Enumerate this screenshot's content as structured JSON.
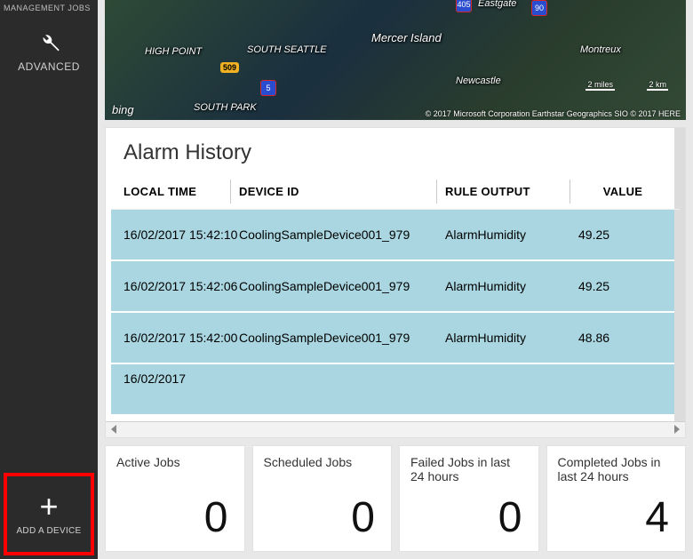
{
  "sidebar": {
    "mgmt_jobs": "MANAGEMENT JOBS",
    "advanced_label": "ADVANCED",
    "add_device_label": "ADD A DEVICE"
  },
  "map": {
    "labels": {
      "high_point": "HIGH POINT",
      "south_seattle": "SOUTH SEATTLE",
      "mercer_island": "Mercer Island",
      "eastgate": "Eastgate",
      "newcastle": "Newcastle",
      "montreux": "Montreux",
      "south_park": "SOUTH PARK"
    },
    "routes": {
      "r509": "509",
      "i5": "5",
      "i405": "405",
      "i90": "90"
    },
    "bing": "bing",
    "scale_miles": "2 miles",
    "scale_km": "2 km",
    "credits": "© 2017 Microsoft Corporation    Earthstar Geographics SIO    © 2017 HERE"
  },
  "alarm": {
    "title": "Alarm History",
    "columns": {
      "local_time": "LOCAL TIME",
      "device_id": "DEVICE ID",
      "rule_output": "RULE OUTPUT",
      "value": "VALUE"
    },
    "rows": [
      {
        "time": "16/02/2017 15:42:10",
        "device": "CoolingSampleDevice001_979",
        "rule": "AlarmHumidity",
        "value": "49.25"
      },
      {
        "time": "16/02/2017 15:42:06",
        "device": "CoolingSampleDevice001_979",
        "rule": "AlarmHumidity",
        "value": "49.25"
      },
      {
        "time": "16/02/2017 15:42:00",
        "device": "CoolingSampleDevice001_979",
        "rule": "AlarmHumidity",
        "value": "48.86"
      }
    ],
    "partial_row_time": "16/02/2017"
  },
  "jobs": [
    {
      "label": "Active Jobs",
      "value": "0"
    },
    {
      "label": "Scheduled Jobs",
      "value": "0"
    },
    {
      "label": "Failed Jobs in last 24 hours",
      "value": "0"
    },
    {
      "label": "Completed Jobs in last 24 hours",
      "value": "4"
    }
  ]
}
